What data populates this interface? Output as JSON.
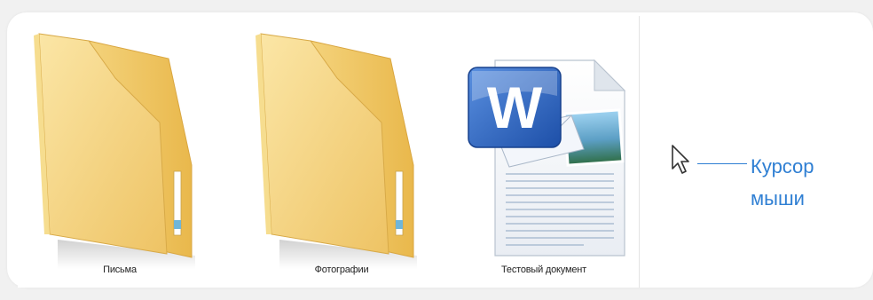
{
  "explorer": {
    "items": [
      {
        "label": "Письма",
        "icon": "folder-icon"
      },
      {
        "label": "Фотографии",
        "icon": "folder-icon"
      },
      {
        "label": "Тестовый документ",
        "icon": "word-document-icon"
      }
    ]
  },
  "annotation": {
    "line1": "Курсор",
    "line2": "мыши",
    "color": "#2f7fd3",
    "icon": "mouse-cursor-icon"
  }
}
